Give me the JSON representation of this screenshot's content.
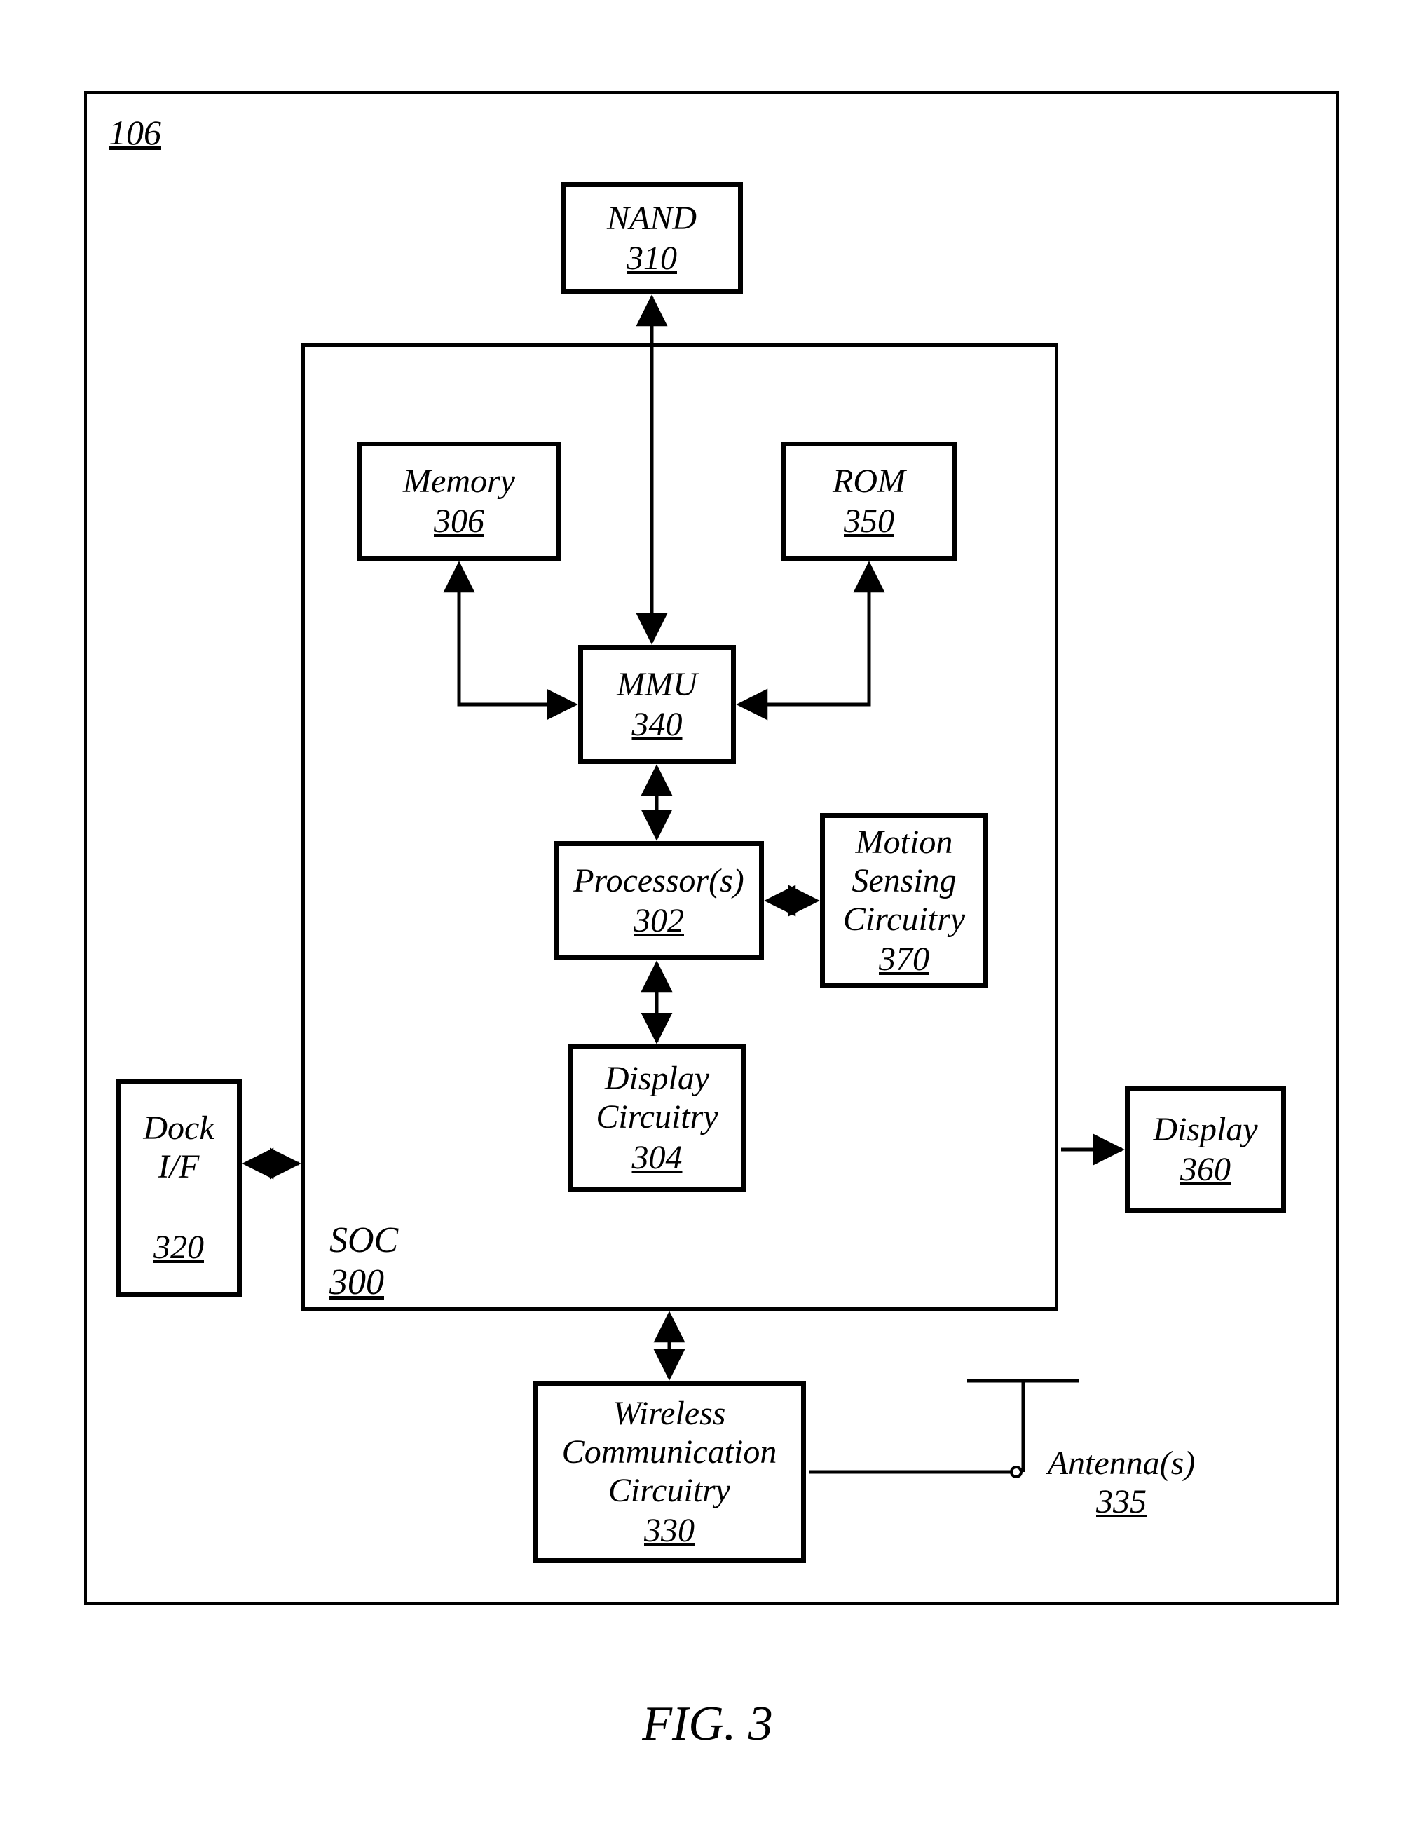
{
  "figure": {
    "caption": "FIG. 3",
    "device_ref": "106"
  },
  "soc": {
    "label": "SOC",
    "ref": "300"
  },
  "blocks": {
    "nand": {
      "label": "NAND",
      "ref": "310"
    },
    "memory": {
      "label": "Memory",
      "ref": "306"
    },
    "rom": {
      "label": "ROM",
      "ref": "350"
    },
    "mmu": {
      "label": "MMU",
      "ref": "340"
    },
    "proc": {
      "label": "Processor(s)",
      "ref": "302"
    },
    "motion": {
      "l1": "Motion",
      "l2": "Sensing",
      "l3": "Circuitry",
      "ref": "370"
    },
    "dispckt": {
      "l1": "Display",
      "l2": "Circuitry",
      "ref": "304"
    },
    "dock": {
      "l1": "Dock",
      "l2": "I/F",
      "ref": "320"
    },
    "display": {
      "label": "Display",
      "ref": "360"
    },
    "wcc": {
      "l1": "Wireless",
      "l2": "Communication",
      "l3": "Circuitry",
      "ref": "330"
    },
    "antenna": {
      "label": "Antenna(s)",
      "ref": "335"
    }
  }
}
